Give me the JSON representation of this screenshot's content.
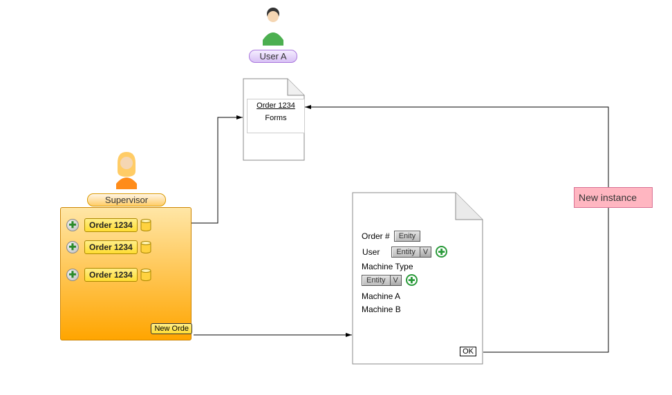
{
  "actors": {
    "supervisor": {
      "label": "Supervisor"
    },
    "user_a": {
      "label": "User A"
    }
  },
  "supervisor_panel": {
    "orders": [
      {
        "label": "Order 1234"
      },
      {
        "label": "Order 1234"
      },
      {
        "label": "Order 1234"
      }
    ],
    "new_order_label": "New Orde"
  },
  "document": {
    "title": "Order 1234",
    "subtitle": "Forms"
  },
  "form": {
    "order_label": "Order #",
    "order_entity": "Enity",
    "user_label": "User",
    "user_entity": "Entity",
    "dropdown_marker": "V",
    "machine_type_label": "Machine Type",
    "machine_entity": "Entity",
    "machines": [
      {
        "name": "Machine A"
      },
      {
        "name": "Machine B"
      }
    ],
    "ok_label": "OK"
  },
  "new_instance": {
    "label": "New instance"
  },
  "icons": {
    "plus": "✚"
  }
}
